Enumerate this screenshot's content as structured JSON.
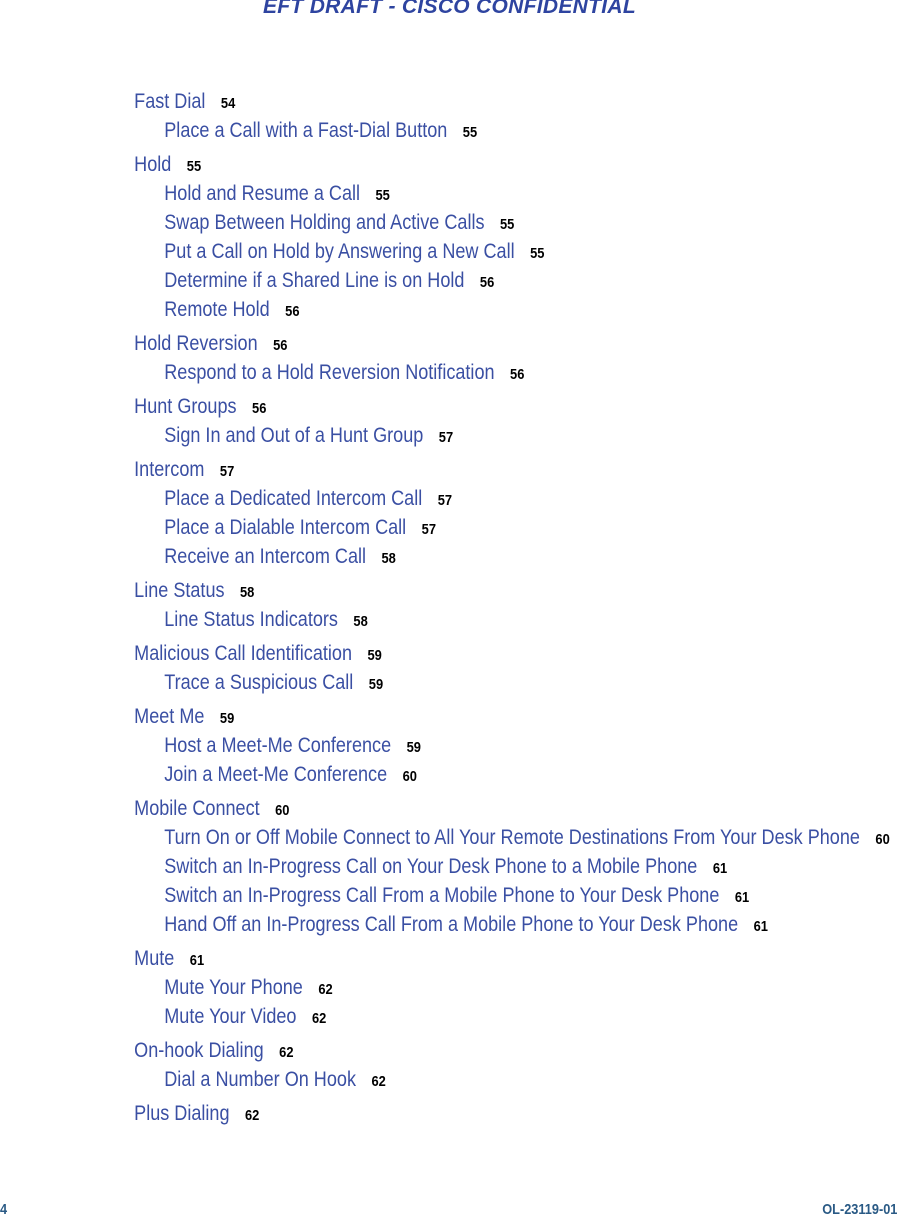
{
  "header": {
    "text": "EFT DRAFT - CISCO CONFIDENTIAL"
  },
  "toc": [
    {
      "level": 1,
      "title": "Fast Dial",
      "page": "54"
    },
    {
      "level": 2,
      "title": "Place a Call with a Fast-Dial Button",
      "page": "55"
    },
    {
      "level": 1,
      "title": "Hold",
      "page": "55"
    },
    {
      "level": 2,
      "title": "Hold and Resume a Call",
      "page": "55"
    },
    {
      "level": 2,
      "title": "Swap Between Holding and Active Calls",
      "page": "55"
    },
    {
      "level": 2,
      "title": "Put a Call on Hold by Answering a New Call",
      "page": "55"
    },
    {
      "level": 2,
      "title": "Determine if a Shared Line is on Hold",
      "page": "56"
    },
    {
      "level": 2,
      "title": "Remote Hold",
      "page": "56"
    },
    {
      "level": 1,
      "title": "Hold Reversion",
      "page": "56"
    },
    {
      "level": 2,
      "title": "Respond to a Hold Reversion Notification",
      "page": "56"
    },
    {
      "level": 1,
      "title": "Hunt Groups",
      "page": "56"
    },
    {
      "level": 2,
      "title": "Sign In and Out of a Hunt Group",
      "page": "57"
    },
    {
      "level": 1,
      "title": "Intercom",
      "page": "57"
    },
    {
      "level": 2,
      "title": "Place a Dedicated Intercom Call",
      "page": "57"
    },
    {
      "level": 2,
      "title": "Place a Dialable Intercom Call",
      "page": "57"
    },
    {
      "level": 2,
      "title": "Receive an Intercom Call",
      "page": "58"
    },
    {
      "level": 1,
      "title": "Line Status",
      "page": "58"
    },
    {
      "level": 2,
      "title": "Line Status Indicators",
      "page": "58"
    },
    {
      "level": 1,
      "title": "Malicious Call Identification",
      "page": "59"
    },
    {
      "level": 2,
      "title": "Trace a Suspicious Call",
      "page": "59"
    },
    {
      "level": 1,
      "title": "Meet Me",
      "page": "59"
    },
    {
      "level": 2,
      "title": "Host a Meet-Me Conference",
      "page": "59"
    },
    {
      "level": 2,
      "title": "Join a Meet-Me Conference",
      "page": "60"
    },
    {
      "level": 1,
      "title": "Mobile Connect",
      "page": "60"
    },
    {
      "level": 2,
      "title": "Turn On or Off Mobile Connect to All Your Remote Destinations From Your Desk Phone",
      "page": "60"
    },
    {
      "level": 2,
      "title": "Switch an In-Progress Call on Your Desk Phone to a Mobile Phone",
      "page": "61"
    },
    {
      "level": 2,
      "title": "Switch an In-Progress Call From a Mobile Phone to Your Desk Phone",
      "page": "61"
    },
    {
      "level": 2,
      "title": "Hand Off an In-Progress Call From a Mobile Phone to Your Desk Phone",
      "page": "61"
    },
    {
      "level": 1,
      "title": "Mute",
      "page": "61"
    },
    {
      "level": 2,
      "title": "Mute Your Phone",
      "page": "62"
    },
    {
      "level": 2,
      "title": "Mute Your Video",
      "page": "62"
    },
    {
      "level": 1,
      "title": "On-hook Dialing",
      "page": "62"
    },
    {
      "level": 2,
      "title": "Dial a Number On Hook",
      "page": "62"
    },
    {
      "level": 1,
      "title": "Plus Dialing",
      "page": "62"
    }
  ],
  "footer": {
    "page_number": "4",
    "doc_id": "OL-23119-01"
  },
  "colors": {
    "link": "#3a4fa3",
    "header": "#2e44a0",
    "footer": "#2a5a85"
  }
}
